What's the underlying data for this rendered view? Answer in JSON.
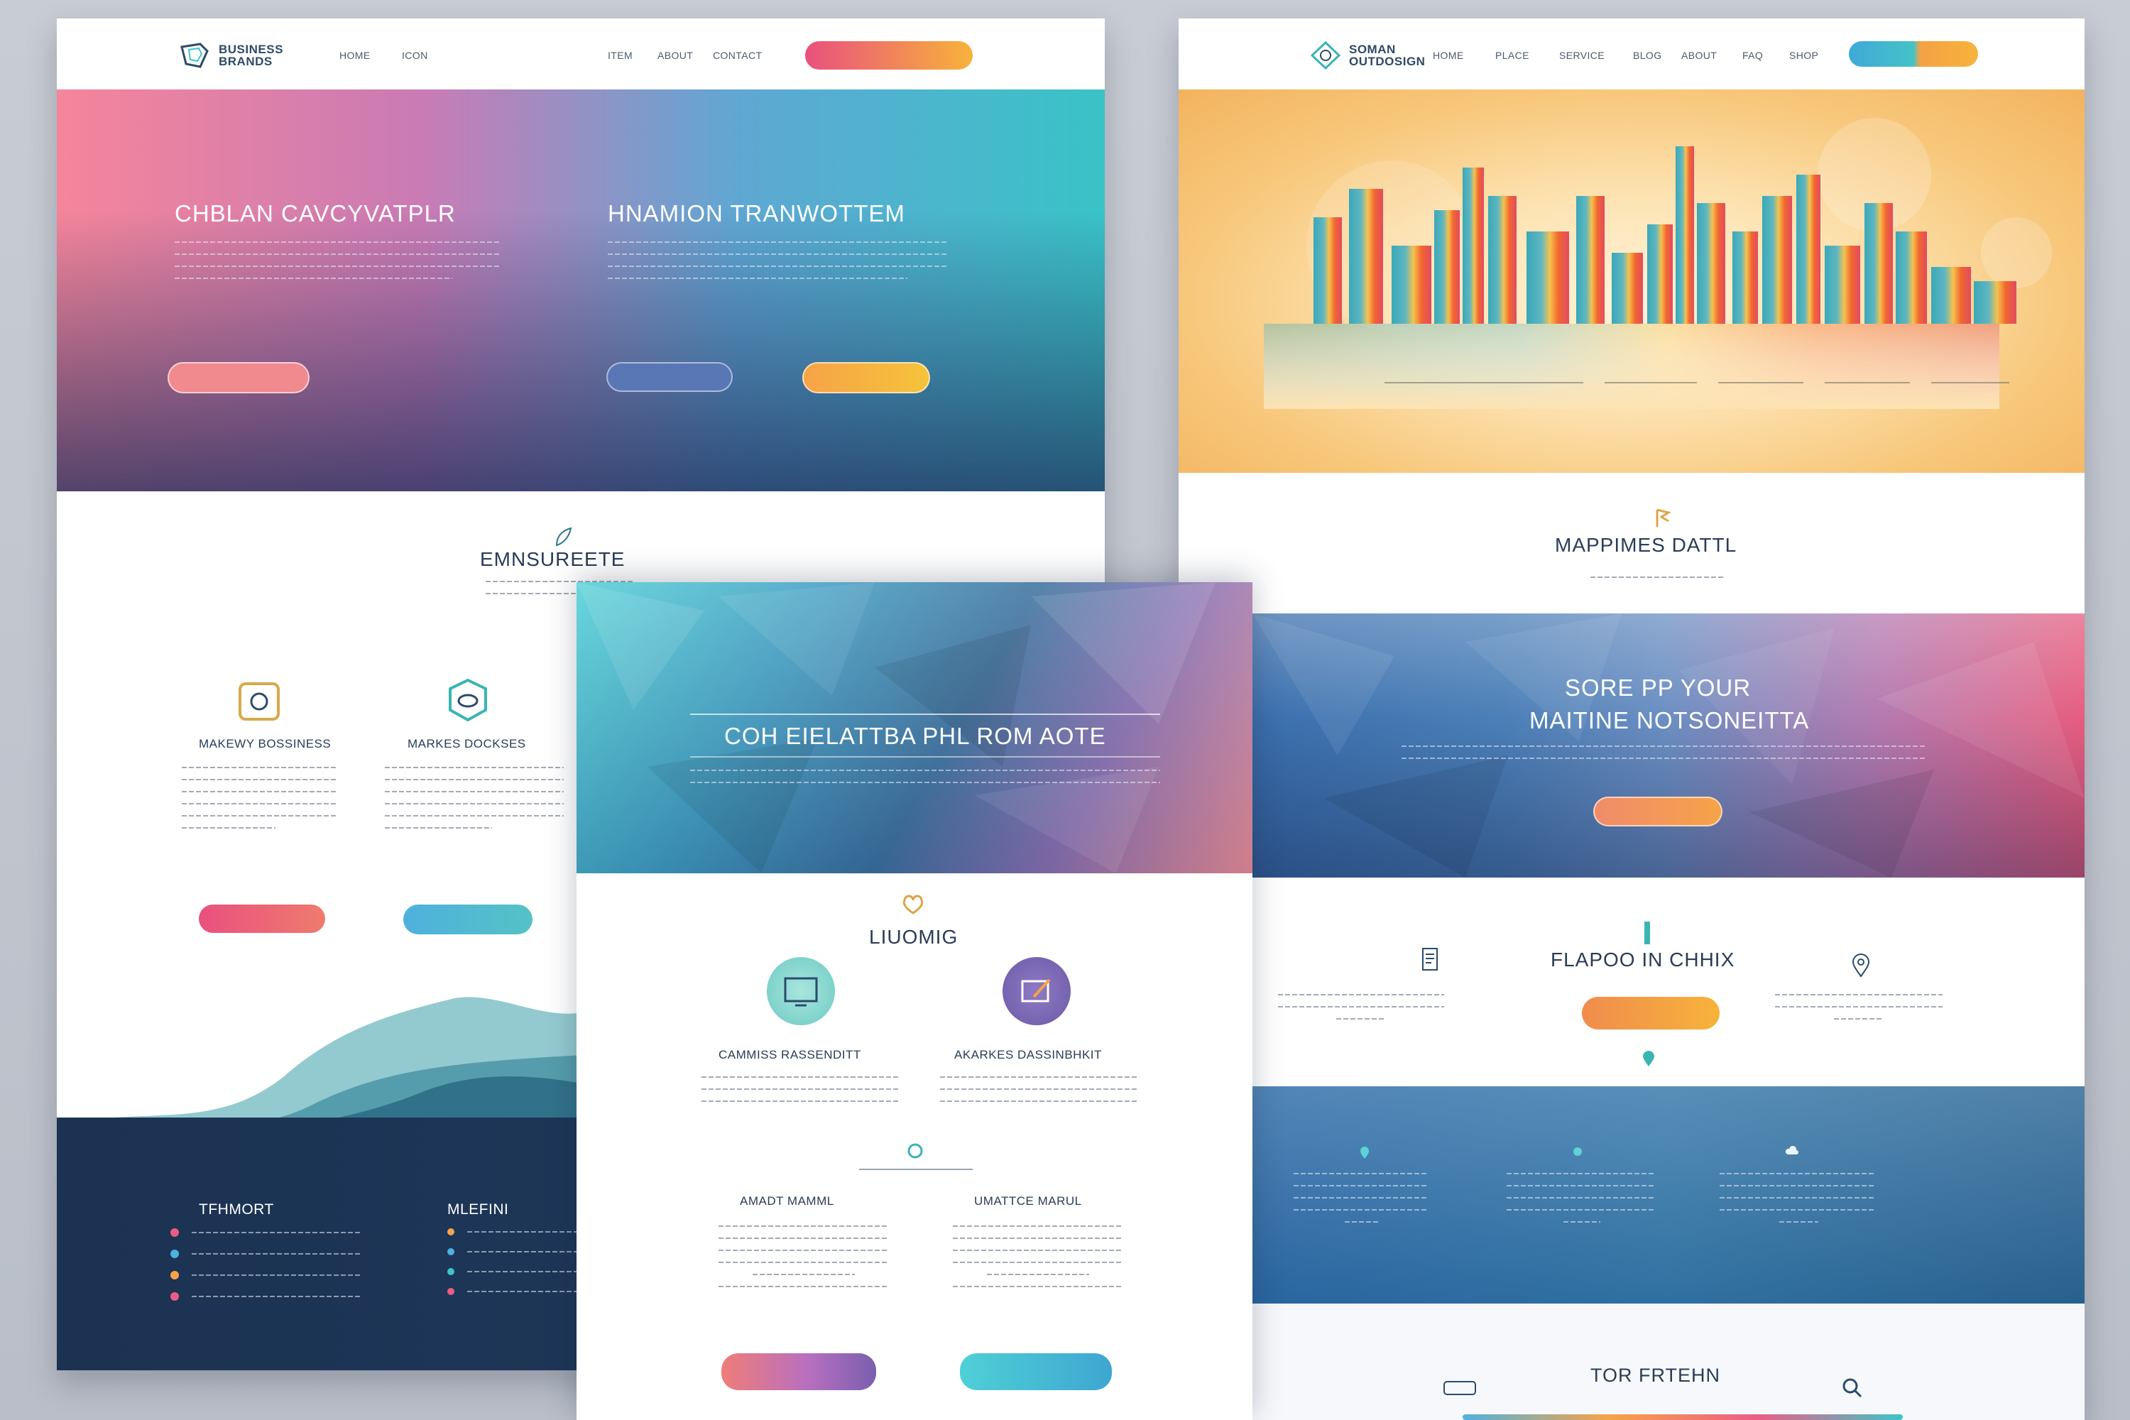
{
  "left": {
    "logo": {
      "line1": "BUSINESS",
      "line2": "BRANDS"
    },
    "nav": [
      "HOME",
      "ICON",
      "ITEM",
      "ABOUT",
      "CONTACT"
    ],
    "hero": {
      "title_left": "CHBLAN CAVCYVATPLR",
      "title_right": "HNAMION TRANWOTTEM"
    },
    "section_title": "EMNSUREETE",
    "features": [
      {
        "title": "MAKEWY BOSSINESS"
      },
      {
        "title": "MARKES DOCKSES"
      }
    ],
    "footer": {
      "col1_title": "TFHMORT",
      "col2_title": "MLEFINI"
    }
  },
  "right": {
    "logo": {
      "line1": "SOMAN",
      "line2": "OUTDOSIGN"
    },
    "nav": [
      "HOME",
      "PLACE",
      "SERVICE",
      "BLOG",
      "ABOUT",
      "FAQ",
      "SHOP"
    ],
    "section_title": "MAPPIMES DATTL",
    "banner": {
      "line1": "SORE PP YOUR",
      "line2": "MAITINE NOTSONEITTA"
    },
    "feature_title": "FLAPOO IN CHHIX",
    "bottom_title": "TOR FRTEHN"
  },
  "center": {
    "hero_title": "COH EIELATTBA PHL ROM AOTE",
    "section_title": "LIUOMIG",
    "cols": [
      {
        "title": "CAMMISS RASSENDITT"
      },
      {
        "title": "AKARKES DASSINBHKIT"
      }
    ],
    "cols2": [
      {
        "title": "AMADT MAMML"
      },
      {
        "title": "UMATTCE MARUL"
      }
    ]
  },
  "colors": {
    "navy": "#1d3556",
    "teal": "#3ec5c9",
    "pink": "#ec5d86",
    "orange": "#f7a347"
  }
}
